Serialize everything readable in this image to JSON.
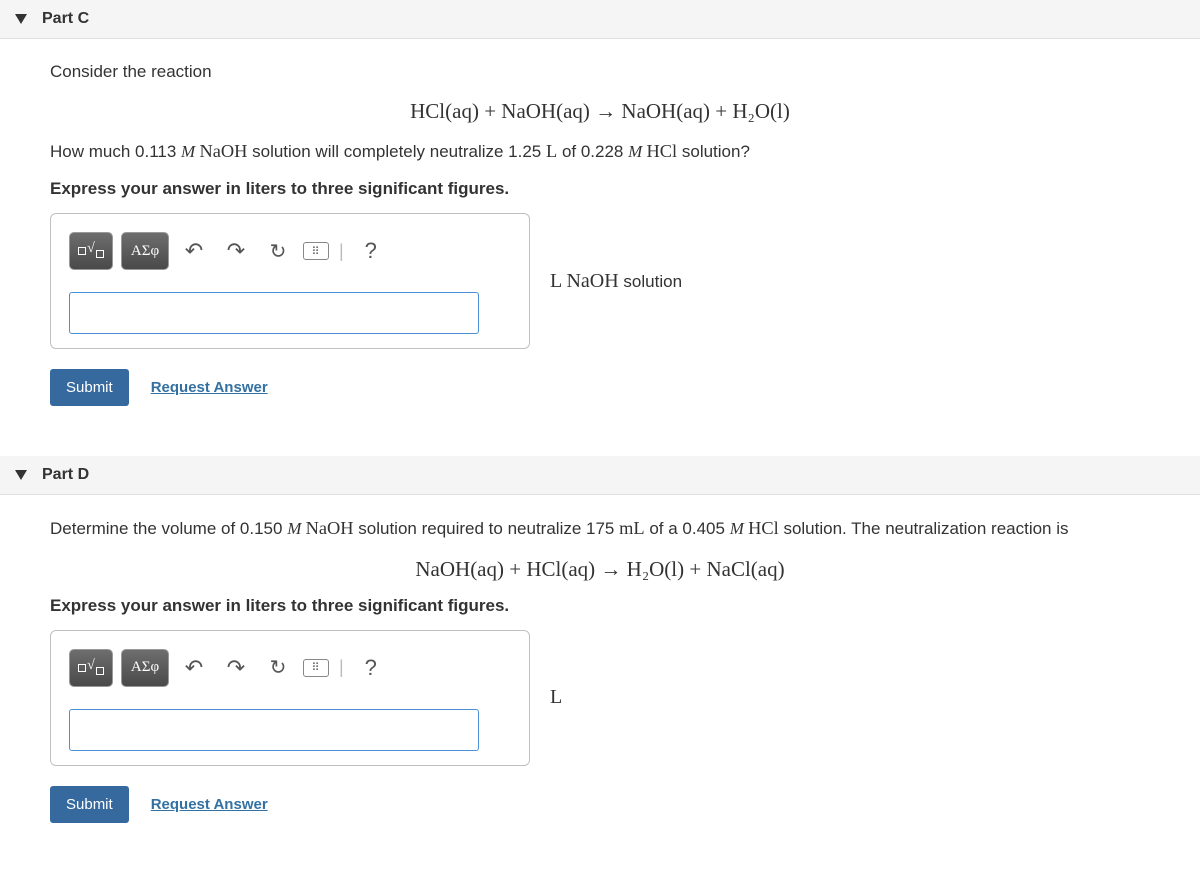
{
  "partC": {
    "title": "Part C",
    "intro": "Consider the reaction",
    "equation": "HCl(aq)  +  NaOH(aq) → NaOH(aq)  +  H₂O(l)",
    "question_pre": "How much 0.113 ",
    "question_m1": "M ",
    "question_chem1": "NaOH",
    "question_mid": " solution will completely neutralize 1.25 ",
    "question_L": "L",
    "question_mid2": " of 0.228 ",
    "question_m2": "M ",
    "question_chem2": "HCl",
    "question_end": " solution?",
    "instruction": "Express your answer in liters to three significant figures.",
    "units_pre": "L ",
    "units_chem": "NaOH",
    "units_post": " solution",
    "submit": "Submit",
    "request": "Request Answer",
    "greek": "ΑΣφ",
    "help": "?"
  },
  "partD": {
    "title": "Part D",
    "question_pre": "Determine the volume of 0.150 ",
    "question_m1": "M ",
    "question_chem1": "NaOH",
    "question_mid": " solution required to neutralize 175 ",
    "question_mL": "mL",
    "question_mid2": " of a 0.405 ",
    "question_m2": "M ",
    "question_chem2": "HCl",
    "question_end": " solution. The neutralization reaction is",
    "equation": "NaOH(aq)  +  HCl(aq) → H₂O(l)  +  NaCl(aq)",
    "instruction": "Express your answer in liters to three significant figures.",
    "units": "L",
    "submit": "Submit",
    "request": "Request Answer",
    "greek": "ΑΣφ",
    "help": "?"
  }
}
